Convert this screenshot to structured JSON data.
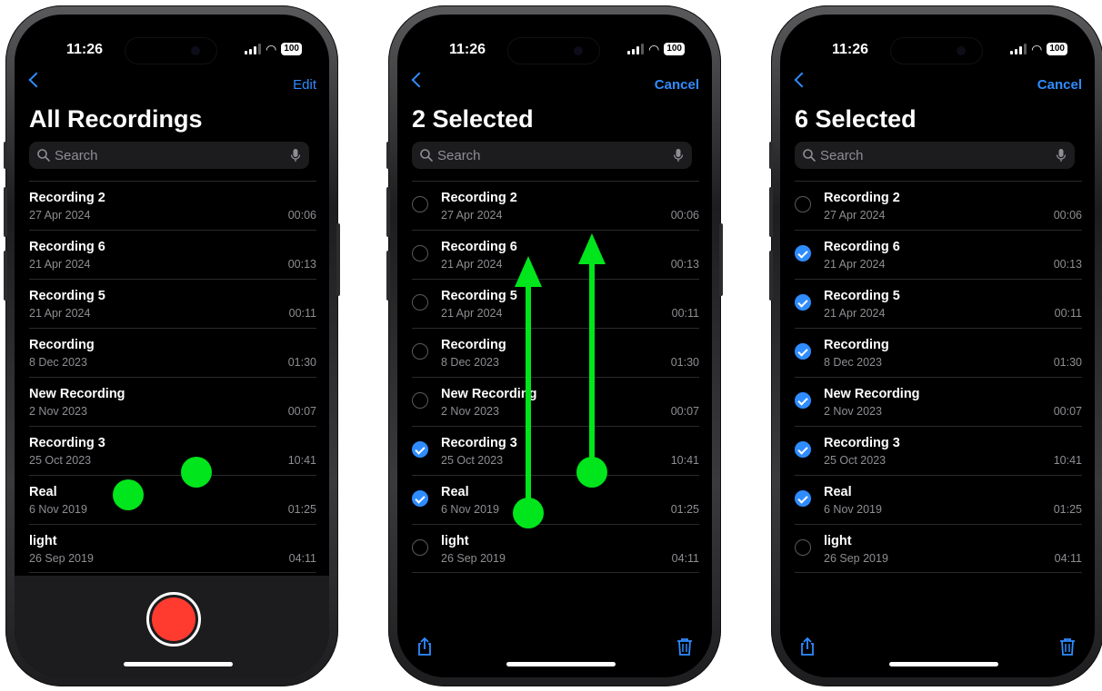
{
  "colors": {
    "accent": "#2f8cff",
    "record": "#ff3b30",
    "gesture": "#00e51b"
  },
  "screens": [
    {
      "time": "11:26",
      "battery": "100",
      "action": "Edit",
      "title": "All Recordings",
      "search_placeholder": "Search",
      "recordings": [
        {
          "name": "Recording 2",
          "date": "27 Apr 2024",
          "duration": "00:06"
        },
        {
          "name": "Recording 6",
          "date": "21 Apr 2024",
          "duration": "00:13"
        },
        {
          "name": "Recording 5",
          "date": "21 Apr 2024",
          "duration": "00:11"
        },
        {
          "name": "Recording",
          "date": "8 Dec 2023",
          "duration": "01:30"
        },
        {
          "name": "New Recording",
          "date": "2 Nov 2023",
          "duration": "00:07"
        },
        {
          "name": "Recording 3",
          "date": "25 Oct 2023",
          "duration": "10:41"
        },
        {
          "name": "Real",
          "date": "6 Nov 2019",
          "duration": "01:25"
        },
        {
          "name": "light",
          "date": "26 Sep 2019",
          "duration": "04:11"
        }
      ]
    },
    {
      "time": "11:26",
      "battery": "100",
      "action": "Cancel",
      "title": "2 Selected",
      "search_placeholder": "Search",
      "recordings": [
        {
          "name": "Recording 2",
          "date": "27 Apr 2024",
          "duration": "00:06",
          "selected": false
        },
        {
          "name": "Recording 6",
          "date": "21 Apr 2024",
          "duration": "00:13",
          "selected": false
        },
        {
          "name": "Recording 5",
          "date": "21 Apr 2024",
          "duration": "00:11",
          "selected": false
        },
        {
          "name": "Recording",
          "date": "8 Dec 2023",
          "duration": "01:30",
          "selected": false
        },
        {
          "name": "New Recording",
          "date": "2 Nov 2023",
          "duration": "00:07",
          "selected": false
        },
        {
          "name": "Recording 3",
          "date": "25 Oct 2023",
          "duration": "10:41",
          "selected": true
        },
        {
          "name": "Real",
          "date": "6 Nov 2019",
          "duration": "01:25",
          "selected": true
        },
        {
          "name": "light",
          "date": "26 Sep 2019",
          "duration": "04:11",
          "selected": false
        }
      ]
    },
    {
      "time": "11:26",
      "battery": "100",
      "action": "Cancel",
      "title": "6 Selected",
      "search_placeholder": "Search",
      "recordings": [
        {
          "name": "Recording 2",
          "date": "27 Apr 2024",
          "duration": "00:06",
          "selected": false
        },
        {
          "name": "Recording 6",
          "date": "21 Apr 2024",
          "duration": "00:13",
          "selected": true
        },
        {
          "name": "Recording 5",
          "date": "21 Apr 2024",
          "duration": "00:11",
          "selected": true
        },
        {
          "name": "Recording",
          "date": "8 Dec 2023",
          "duration": "01:30",
          "selected": true
        },
        {
          "name": "New Recording",
          "date": "2 Nov 2023",
          "duration": "00:07",
          "selected": true
        },
        {
          "name": "Recording 3",
          "date": "25 Oct 2023",
          "duration": "10:41",
          "selected": true
        },
        {
          "name": "Real",
          "date": "6 Nov 2019",
          "duration": "01:25",
          "selected": true
        },
        {
          "name": "light",
          "date": "26 Sep 2019",
          "duration": "04:11",
          "selected": false
        }
      ]
    }
  ]
}
